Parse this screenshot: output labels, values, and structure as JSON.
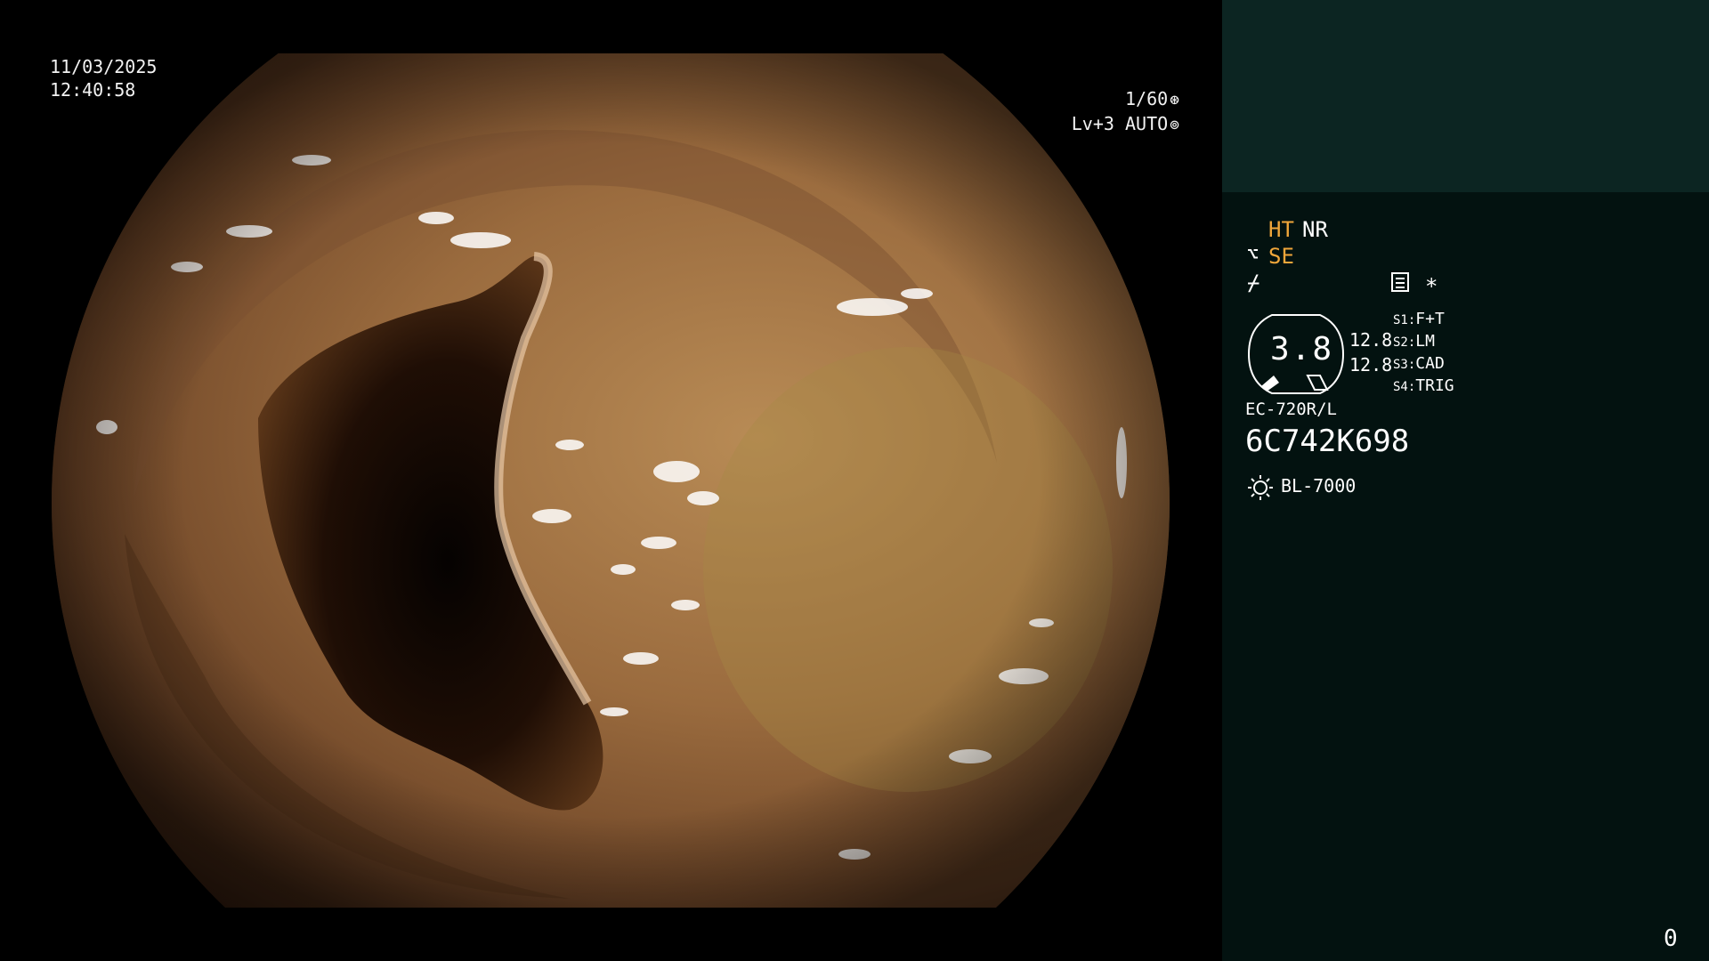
{
  "overlay": {
    "date": "11/03/2025",
    "time": "12:40:58",
    "shutter": "1/60",
    "shutter_icon": "shutter-icon",
    "exposure_level": "Lv+3",
    "exposure_mode": "AUTO",
    "exposure_icon": "iris-icon"
  },
  "panel": {
    "ht": "HT",
    "nr": "NR",
    "se": "SE",
    "se_symbol": "⌥",
    "flash_symbol": "⌿",
    "star": "*",
    "gauge_value": "3.8",
    "gauge_left": "12.8",
    "gauge_right": "12.8",
    "slots": [
      {
        "id": "S1",
        "value": "F+T"
      },
      {
        "id": "S2",
        "value": "LM"
      },
      {
        "id": "S3",
        "value": "CAD"
      },
      {
        "id": "S4",
        "value": "TRIG"
      }
    ],
    "scope_model": "EC-720R/L",
    "scope_serial": "6C742K698",
    "light_source": "BL-7000",
    "light_icon": "sun-icon",
    "counter": "0"
  },
  "colors": {
    "panel_bg": "#031210",
    "panel_header": "#0c2522",
    "accent_orange": "#f0a63a",
    "text": "#ffffff"
  }
}
